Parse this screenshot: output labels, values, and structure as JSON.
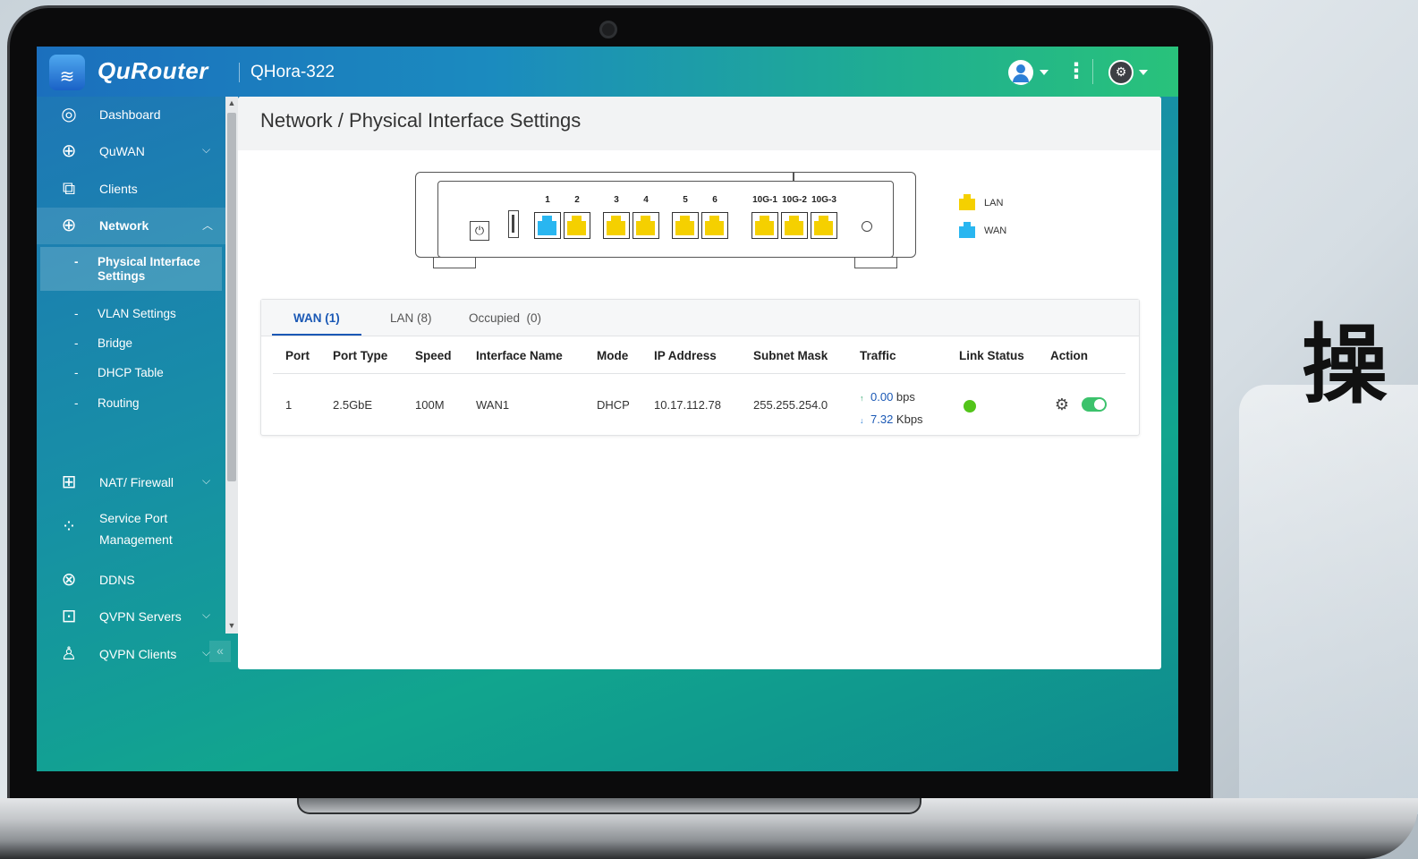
{
  "background": {
    "cjk_char": "操"
  },
  "topbar": {
    "brand": "QuRouter",
    "device": "QHora-322",
    "icons": [
      "router-logo-icon",
      "user-avatar-icon",
      "more-vertical-icon",
      "settings-globe-icon"
    ]
  },
  "sidebar": {
    "items": [
      {
        "label": "Dashboard",
        "icon": "dashboard-icon"
      },
      {
        "label": "QuWAN",
        "icon": "quwan-icon",
        "expandable": true
      },
      {
        "label": "Clients",
        "icon": "clients-icon"
      },
      {
        "label": "Network",
        "icon": "globe-icon",
        "expanded": true
      },
      {
        "label": "NAT/ Firewall",
        "icon": "firewall-icon",
        "expandable": true
      },
      {
        "label": "Service Port Management",
        "icon": "service-port-icon"
      },
      {
        "label": "DDNS",
        "icon": "ddns-icon"
      },
      {
        "label": "QVPN Servers",
        "icon": "lock-icon",
        "expandable": true
      },
      {
        "label": "QVPN Clients",
        "icon": "vpn-client-icon",
        "expandable": true
      }
    ],
    "network_sub": [
      {
        "label": "Physical Interface Settings",
        "active": true
      },
      {
        "label": "VLAN Settings"
      },
      {
        "label": "Bridge"
      },
      {
        "label": "DHCP Table"
      },
      {
        "label": "Routing"
      }
    ],
    "service_port_line1": "Service Port",
    "service_port_line2": "Management",
    "dash": "-"
  },
  "page": {
    "title": "Network / Physical Interface Settings"
  },
  "device_panel": {
    "ports": [
      {
        "label": "1",
        "type": "WAN"
      },
      {
        "label": "2",
        "type": "LAN"
      },
      {
        "label": "3",
        "type": "LAN"
      },
      {
        "label": "4",
        "type": "LAN"
      },
      {
        "label": "5",
        "type": "LAN"
      },
      {
        "label": "6",
        "type": "LAN"
      },
      {
        "label": "10G-1",
        "type": "LAN"
      },
      {
        "label": "10G-2",
        "type": "LAN"
      },
      {
        "label": "10G-3",
        "type": "LAN"
      }
    ],
    "legend": [
      {
        "label": "LAN",
        "color": "#f5d000"
      },
      {
        "label": "WAN",
        "color": "#29b6f0"
      }
    ],
    "power_symbol": "⏻"
  },
  "tabs": [
    {
      "label": "WAN (1)",
      "active": true
    },
    {
      "label": "LAN (8)"
    },
    {
      "label": "Occupied  (0)"
    }
  ],
  "table": {
    "columns": [
      "Port",
      "Port Type",
      "Speed",
      "Interface Name",
      "Mode",
      "IP Address",
      "Subnet Mask",
      "Traffic",
      "Link Status",
      "Action"
    ],
    "rows": [
      {
        "port": "1",
        "port_type": "2.5GbE",
        "speed": "100M",
        "interface_name": "WAN1",
        "mode": "DHCP",
        "ip": "10.17.112.78",
        "subnet": "255.255.254.0",
        "traffic_up_value": "0.00",
        "traffic_up_unit": " bps",
        "traffic_down_value": "7.32",
        "traffic_down_unit": " Kbps",
        "link_status_color": "#52c41a",
        "enabled": true
      }
    ]
  },
  "colors": {
    "accent": "#1a58b5",
    "toggle_on": "#3cc26c"
  }
}
